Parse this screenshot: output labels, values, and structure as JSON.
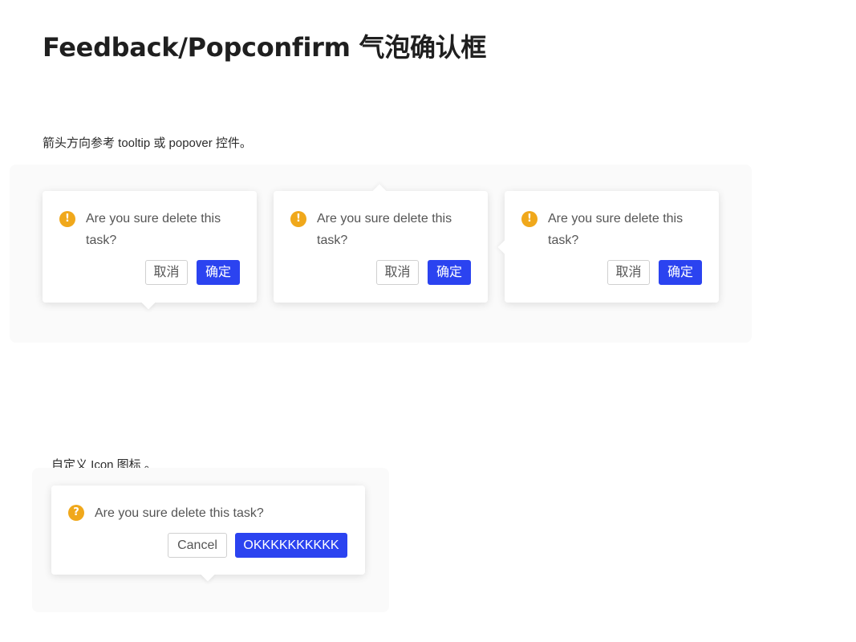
{
  "page": {
    "title": "Feedback/Popconfirm 气泡确认框"
  },
  "section_arrow": {
    "description": "箭头方向参考 tooltip 或 popover 控件。",
    "popconfirms": [
      {
        "placement": "bottom",
        "icon": "exclamation-icon",
        "icon_glyph": "!",
        "message": "Are you sure delete this task?",
        "cancel_label": "取消",
        "ok_label": "确定"
      },
      {
        "placement": "top",
        "icon": "exclamation-icon",
        "icon_glyph": "!",
        "message": "Are you sure delete this task?",
        "cancel_label": "取消",
        "ok_label": "确定"
      },
      {
        "placement": "left",
        "icon": "exclamation-icon",
        "icon_glyph": "!",
        "message": "Are you sure delete this task?",
        "cancel_label": "取消",
        "ok_label": "确定"
      }
    ]
  },
  "section_custom_icon": {
    "description": "自定义 Icon 图标 。",
    "popconfirm": {
      "placement": "bottom",
      "icon": "question-icon",
      "icon_glyph": "?",
      "message": "Are you sure delete this task?",
      "cancel_label": "Cancel",
      "ok_label": "OKKKKKKKKKK"
    }
  },
  "colors": {
    "primary": "#2b43f0",
    "warning": "#f0a81b",
    "text": "#555555",
    "title": "#1f1f1f"
  }
}
